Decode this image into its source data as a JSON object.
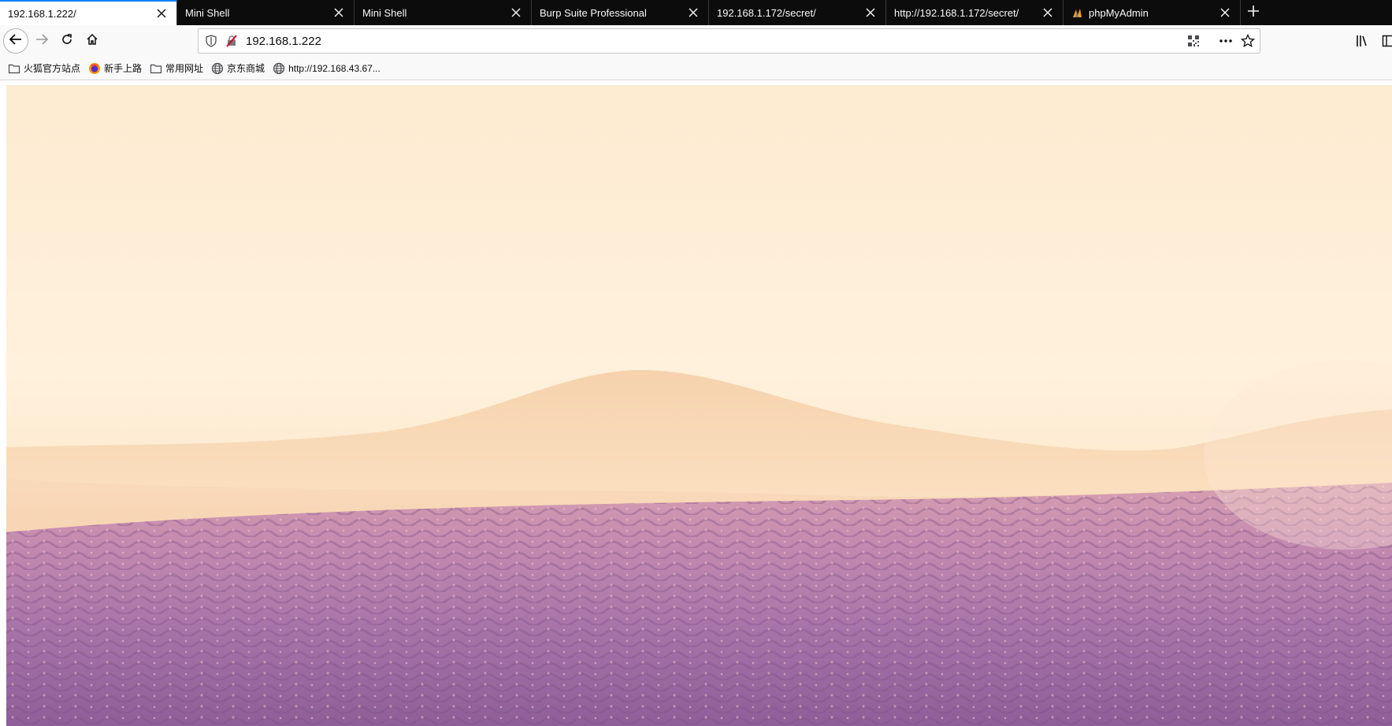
{
  "browser": {
    "tabs": [
      {
        "title": "192.168.1.222/",
        "active": true,
        "favicon": "none"
      },
      {
        "title": "Mini Shell",
        "active": false,
        "favicon": "none"
      },
      {
        "title": "Mini Shell",
        "active": false,
        "favicon": "none"
      },
      {
        "title": "Burp Suite Professional",
        "active": false,
        "favicon": "none"
      },
      {
        "title": "192.168.1.172/secret/",
        "active": false,
        "favicon": "none"
      },
      {
        "title": "http://192.168.1.172/secret/",
        "active": false,
        "favicon": "none"
      },
      {
        "title": "phpMyAdmin",
        "active": false,
        "favicon": "phpmyadmin-icon"
      }
    ],
    "url": "192.168.1.222",
    "bookmarks": [
      {
        "label": "火狐官方站点",
        "icon": "folder-icon"
      },
      {
        "label": "新手上路",
        "icon": "firefox-icon"
      },
      {
        "label": "常用网址",
        "icon": "folder-icon"
      },
      {
        "label": "京东商城",
        "icon": "globe-icon"
      },
      {
        "label": "http://192.168.43.67...",
        "icon": "globe-icon"
      }
    ],
    "colors": {
      "tabstrip_bg": "#0c0c0d",
      "active_tab_accent": "#0a84ff",
      "toolbar_bg": "#f9f9fa"
    }
  },
  "page": {
    "background": "lavender-field-sunrise-image"
  }
}
